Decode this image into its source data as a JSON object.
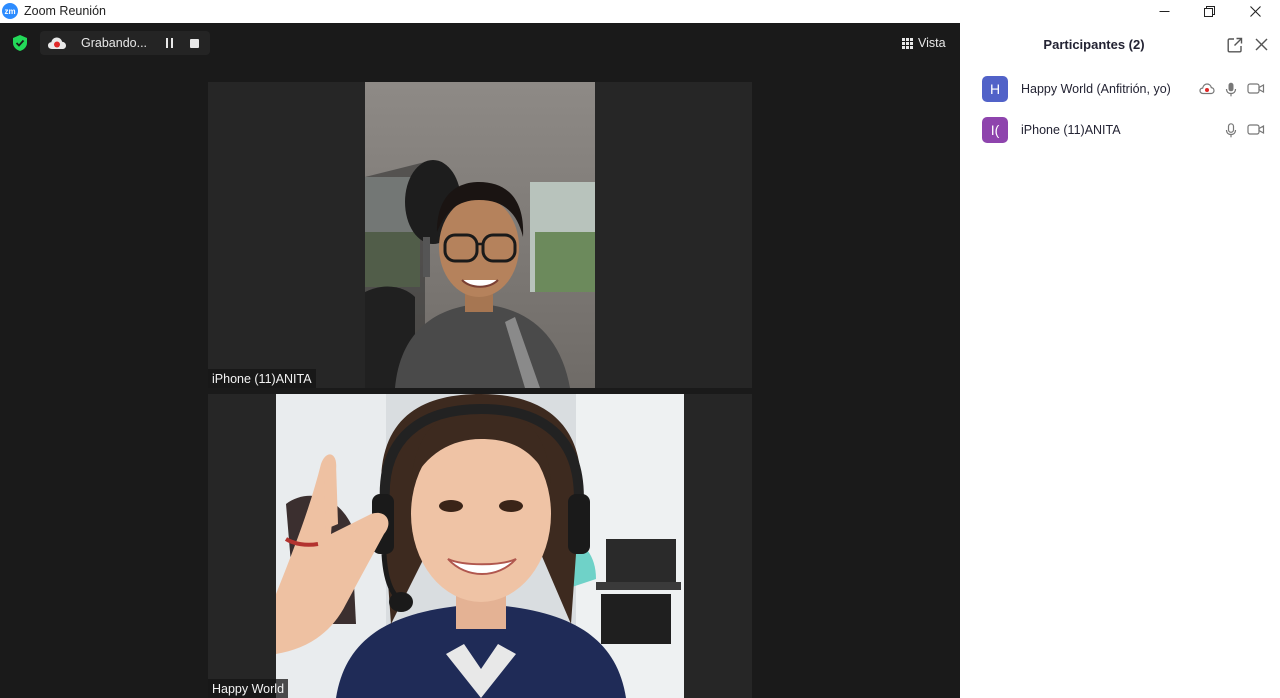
{
  "window": {
    "title": "Zoom Reunión",
    "logo_text": "zm"
  },
  "meeting": {
    "recording": {
      "status_text": "Grabando..."
    },
    "view_label": "Vista",
    "tiles": [
      {
        "name": "iPhone (11)ANITA"
      },
      {
        "name": "Happy World"
      }
    ]
  },
  "participants_panel": {
    "title": "Participantes (2)",
    "participants": [
      {
        "name": "Happy World (Anfitrión, yo)",
        "initials": "H",
        "avatar_color": "#5162C8"
      },
      {
        "name": "iPhone (11)ANITA",
        "initials": "I(",
        "avatar_color": "#8E44AD"
      }
    ]
  },
  "colors": {
    "meeting_bg": "#1a1a1a",
    "tile_bg": "#262626",
    "security_green": "#23D959",
    "recording_red": "#E02828",
    "zoom_blue": "#2D8CFF"
  }
}
